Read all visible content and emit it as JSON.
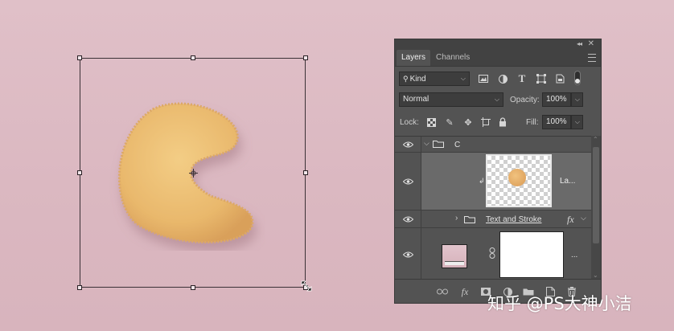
{
  "panel": {
    "tabs": [
      {
        "label": "Layers"
      },
      {
        "label": "Channels"
      }
    ],
    "filter": {
      "kind_label": "Kind"
    },
    "blend_mode": "Normal",
    "opacity_label": "Opacity:",
    "opacity_value": "100%",
    "lock_label": "Lock:",
    "fill_label": "Fill:",
    "fill_value": "100%",
    "layers": [
      {
        "name": "C",
        "type": "group",
        "expanded": true
      },
      {
        "name": "La...",
        "type": "smart-object-clipped"
      },
      {
        "name": "Text and Stroke",
        "type": "group",
        "fx": "fx"
      },
      {
        "name": "...",
        "type": "layer-with-mask"
      }
    ],
    "bottom_icons": [
      "link-icon",
      "fx-icon",
      "mask-icon",
      "adjustment-icon",
      "folder-icon",
      "new-layer-icon",
      "trash-icon"
    ]
  },
  "watermark": "知乎 @PS大神小洁",
  "colors": {
    "background": "#dbb8c1",
    "panel": "#535353",
    "cookie": "#e8b86e"
  }
}
